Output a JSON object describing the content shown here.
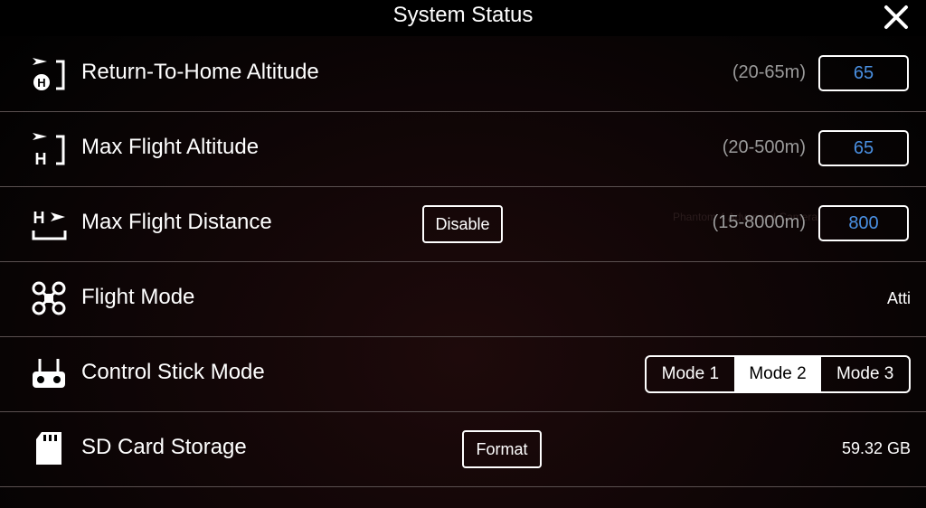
{
  "header": {
    "title": "System Status"
  },
  "rows": [
    {
      "label": "Return-To-Home Altitude",
      "range": "(20-65m)",
      "value": "65"
    },
    {
      "label": "Max Flight Altitude",
      "range": "(20-500m)",
      "value": "65"
    },
    {
      "label": "Max Flight Distance",
      "button": "Disable",
      "range": "(15-8000m)",
      "value": "800"
    },
    {
      "label": "Flight Mode",
      "value": "Atti"
    },
    {
      "label": "Control Stick Mode",
      "modes": [
        "Mode 1",
        "Mode 2",
        "Mode 3"
      ],
      "selected": "Mode 2"
    },
    {
      "label": "SD Card Storage",
      "button": "Format",
      "value": "59.32 GB"
    }
  ],
  "colors": {
    "accent": "#4a90e2",
    "background": "#120607",
    "divider": "#5a5050"
  },
  "icons": [
    "close-icon",
    "return-home-altitude-icon",
    "max-altitude-icon",
    "max-distance-icon",
    "drone-icon",
    "remote-controller-icon",
    "sd-card-icon"
  ]
}
